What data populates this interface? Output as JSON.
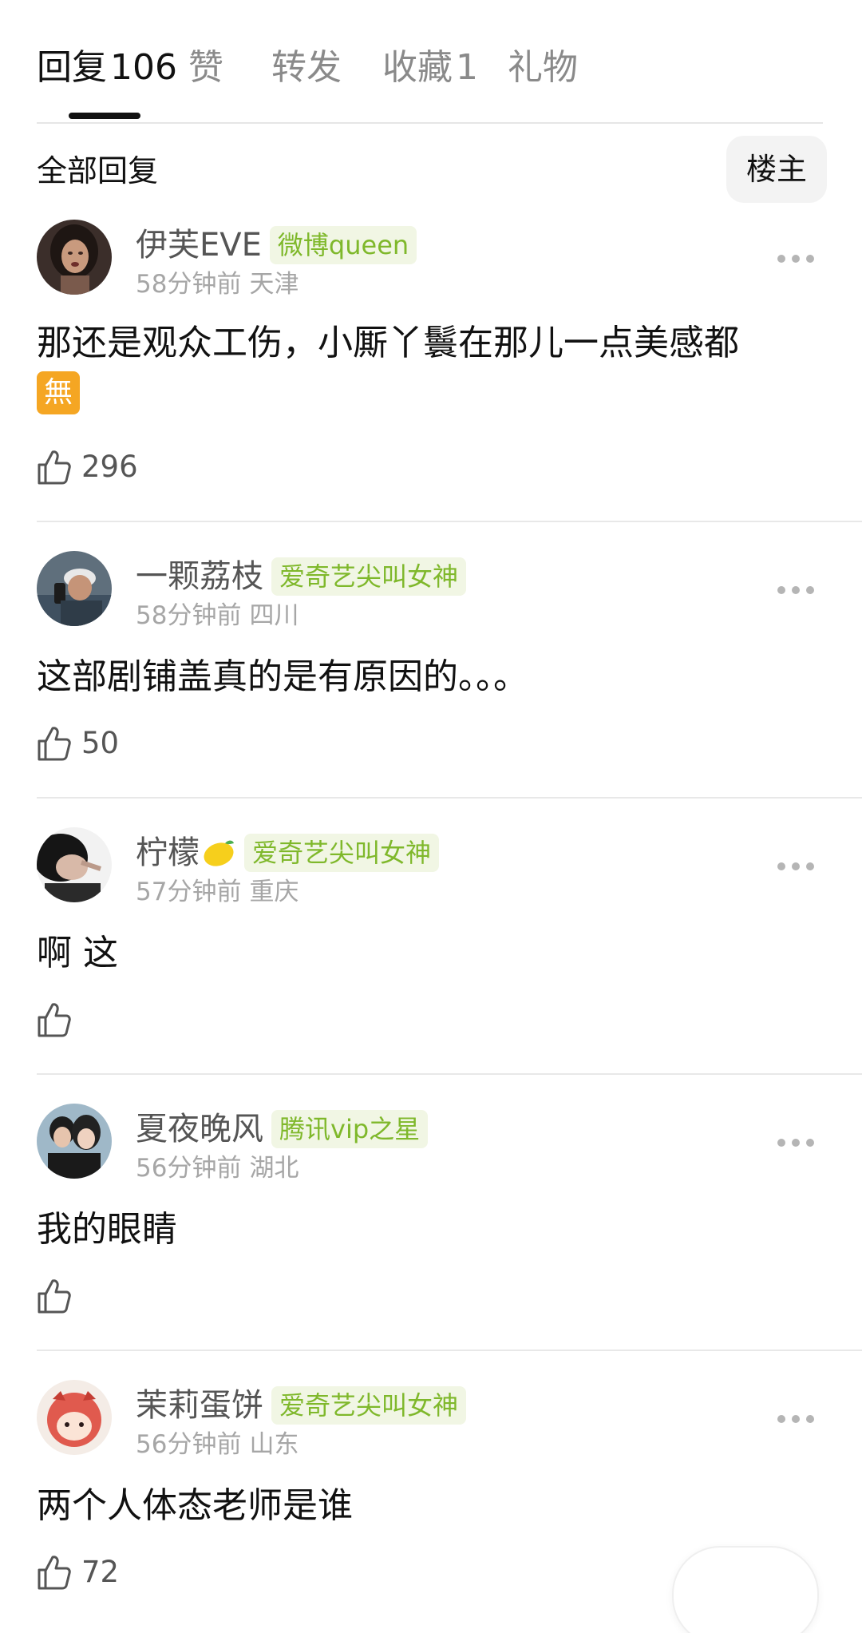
{
  "tabs": [
    {
      "label": "回复",
      "count": "106",
      "active": true
    },
    {
      "label": "赞",
      "count": ""
    },
    {
      "label": "转发",
      "count": ""
    },
    {
      "label": "收藏",
      "count": "1"
    },
    {
      "label": "礼物",
      "count": ""
    }
  ],
  "filter": {
    "title": "全部回复",
    "owner_button": "楼主"
  },
  "comments": [
    {
      "name": "伊芙EVE",
      "badge": "微博queen",
      "time": "58分钟前",
      "location": "天津",
      "text": "那还是观众工伤，小厮丫鬟在那儿一点美感都",
      "text_emoji": "無",
      "likes": "296"
    },
    {
      "name": "一颗荔枝",
      "badge": "爱奇艺尖叫女神",
      "time": "58分钟前",
      "location": "四川",
      "text": "这部剧铺盖真的是有原因的。。。",
      "likes": "50"
    },
    {
      "name": "柠檬",
      "name_emoji": "lemon-emoji",
      "badge": "爱奇艺尖叫女神",
      "time": "57分钟前",
      "location": "重庆",
      "text": "啊 这",
      "likes": ""
    },
    {
      "name": "夏夜晚风",
      "badge": "腾讯vip之星",
      "time": "56分钟前",
      "location": "湖北",
      "text": "我的眼睛",
      "likes": ""
    },
    {
      "name": "茉莉蛋饼",
      "badge": "爱奇艺尖叫女神",
      "time": "56分钟前",
      "location": "山东",
      "text": "两个人体态老师是谁",
      "likes": "72"
    }
  ],
  "icons": {
    "like": "thumbs-up-icon",
    "more": "more-dots-icon"
  },
  "colors": {
    "badge_text": "#7fb82b",
    "badge_bg": "#f1f6e4",
    "muted": "#a6a6a6",
    "emoji_box": "#f5a623"
  }
}
